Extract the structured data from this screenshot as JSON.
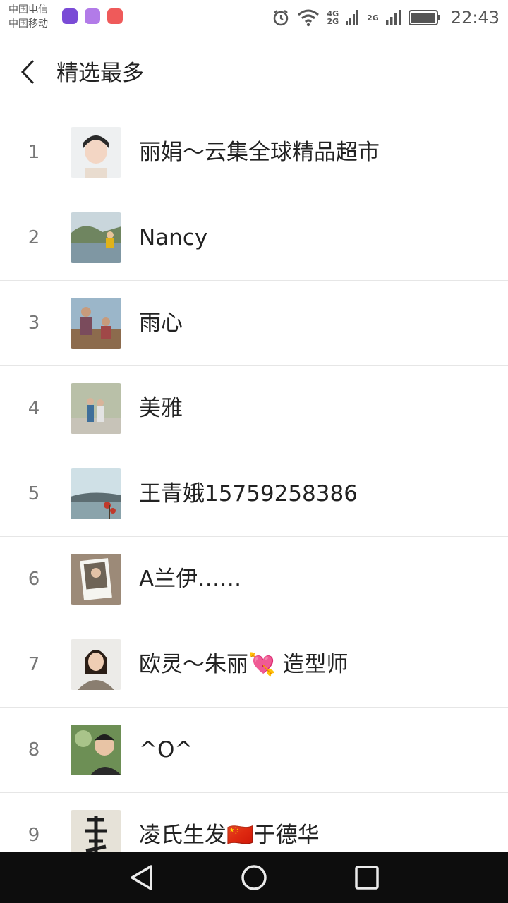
{
  "status_bar": {
    "carrier_1": "中国电信",
    "carrier_2": "中国移动",
    "net_a_top": "4G",
    "net_a_bottom": "2G",
    "net_b": "2G",
    "time": "22:43"
  },
  "header": {
    "title": "精选最多"
  },
  "list": [
    {
      "rank": "1",
      "name": "丽娟～云集全球精品超市"
    },
    {
      "rank": "2",
      "name": "Nancy"
    },
    {
      "rank": "3",
      "name": "雨心"
    },
    {
      "rank": "4",
      "name": "美雅"
    },
    {
      "rank": "5",
      "name": "王青娥15759258386"
    },
    {
      "rank": "6",
      "name": "A兰伊……"
    },
    {
      "rank": "7",
      "name": "欧灵～朱丽💘 造型师"
    },
    {
      "rank": "8",
      "name": "^O^"
    },
    {
      "rank": "9",
      "name": "凌氏生发🇨🇳于德华"
    }
  ]
}
